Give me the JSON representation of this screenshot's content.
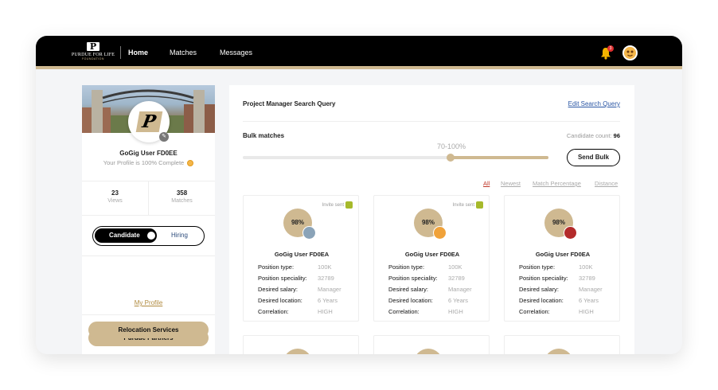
{
  "header": {
    "logo_mark": "P",
    "logo_text": "PURDUE FOR LIFE",
    "logo_sub": "FOUNDATION",
    "nav": [
      {
        "label": "Home",
        "active": true
      },
      {
        "label": "Matches",
        "active": false
      },
      {
        "label": "Messages",
        "active": false
      }
    ],
    "notification_count": "3",
    "bell_icon": "bell-icon",
    "avatar_icon": "user-avatar-icon"
  },
  "sidebar": {
    "username": "GoGig User FD0EE",
    "profile_complete": "Your Profile is 100% Complete",
    "stats": [
      {
        "value": "23",
        "label": "Views"
      },
      {
        "label": "Matches",
        "value": "358"
      }
    ],
    "toggle": {
      "active": "Candidate",
      "inactive": "Hiring"
    },
    "my_profile": "My Profile",
    "buttons": [
      "Purdue Partners",
      "Relocation Services"
    ],
    "profile_logo": "P"
  },
  "main": {
    "query_title": "Project Manager Search Query",
    "edit_link": "Edit Search Query",
    "bulk_label": "Bulk matches",
    "candidate_count_label": "Candidate count:",
    "candidate_count": "96",
    "range_label": "70-100%",
    "slider_value_pct": 70,
    "send_bulk": "Send Bulk",
    "sort_options": [
      "All",
      "Newest",
      "Match Percentage",
      "Distance"
    ],
    "sort_active": "All",
    "labels": {
      "position_type": "Position type:",
      "position_speciality": "Position speciality:",
      "desired_salary": "Desired salary:",
      "desired_location": "Desired location:",
      "correlation": "Correlation:"
    },
    "cards": [
      {
        "invite": "Invite sent",
        "percent": "98%",
        "name": "GoGig User FD0EA",
        "position_type": "100K",
        "position_speciality": "32789",
        "desired_salary": "Manager",
        "desired_location": "6 Years",
        "correlation": "HIGH",
        "avatar_color": "#8aa3b8"
      },
      {
        "invite": "Invite sent",
        "percent": "98%",
        "name": "GoGig User FD0EA",
        "position_type": "100K",
        "position_speciality": "32789",
        "desired_salary": "Manager",
        "desired_location": "6 Years",
        "correlation": "HIGH",
        "avatar_color": "#f0a23a"
      },
      {
        "invite": "",
        "percent": "98%",
        "name": "GoGig User FD0EA",
        "position_type": "100K",
        "position_speciality": "32789",
        "desired_salary": "Manager",
        "desired_location": "6 Years",
        "correlation": "HIGH",
        "avatar_color": "#b32b2b"
      }
    ]
  },
  "colors": {
    "gold": "#cfb991",
    "black": "#000000",
    "link": "#2a56a4",
    "sort_active": "#c0392b"
  }
}
